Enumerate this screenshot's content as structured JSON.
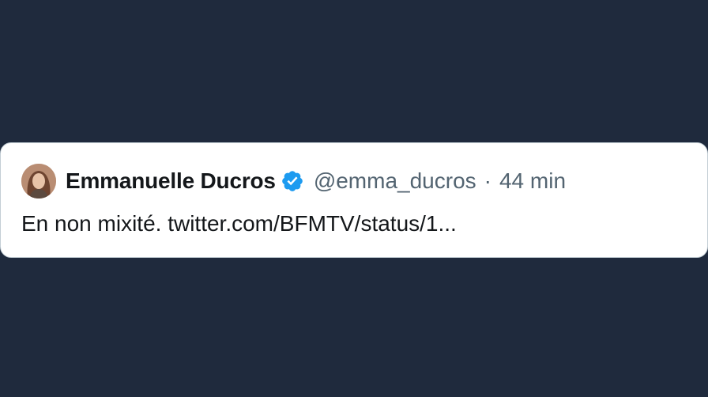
{
  "tweet": {
    "author": {
      "display_name": "Emmanuelle Ducros",
      "handle": "@emma_ducros",
      "verified_icon": "verified-badge-icon",
      "avatar_icon": "avatar-photo"
    },
    "separator": "·",
    "timestamp": "44 min",
    "text": "En non mixité. twitter.com/BFMTV/status/1..."
  },
  "colors": {
    "background": "#1f2a3d",
    "card": "#ffffff",
    "verified": "#1d9bf0",
    "secondary_text": "#536471",
    "primary_text": "#14171a"
  }
}
